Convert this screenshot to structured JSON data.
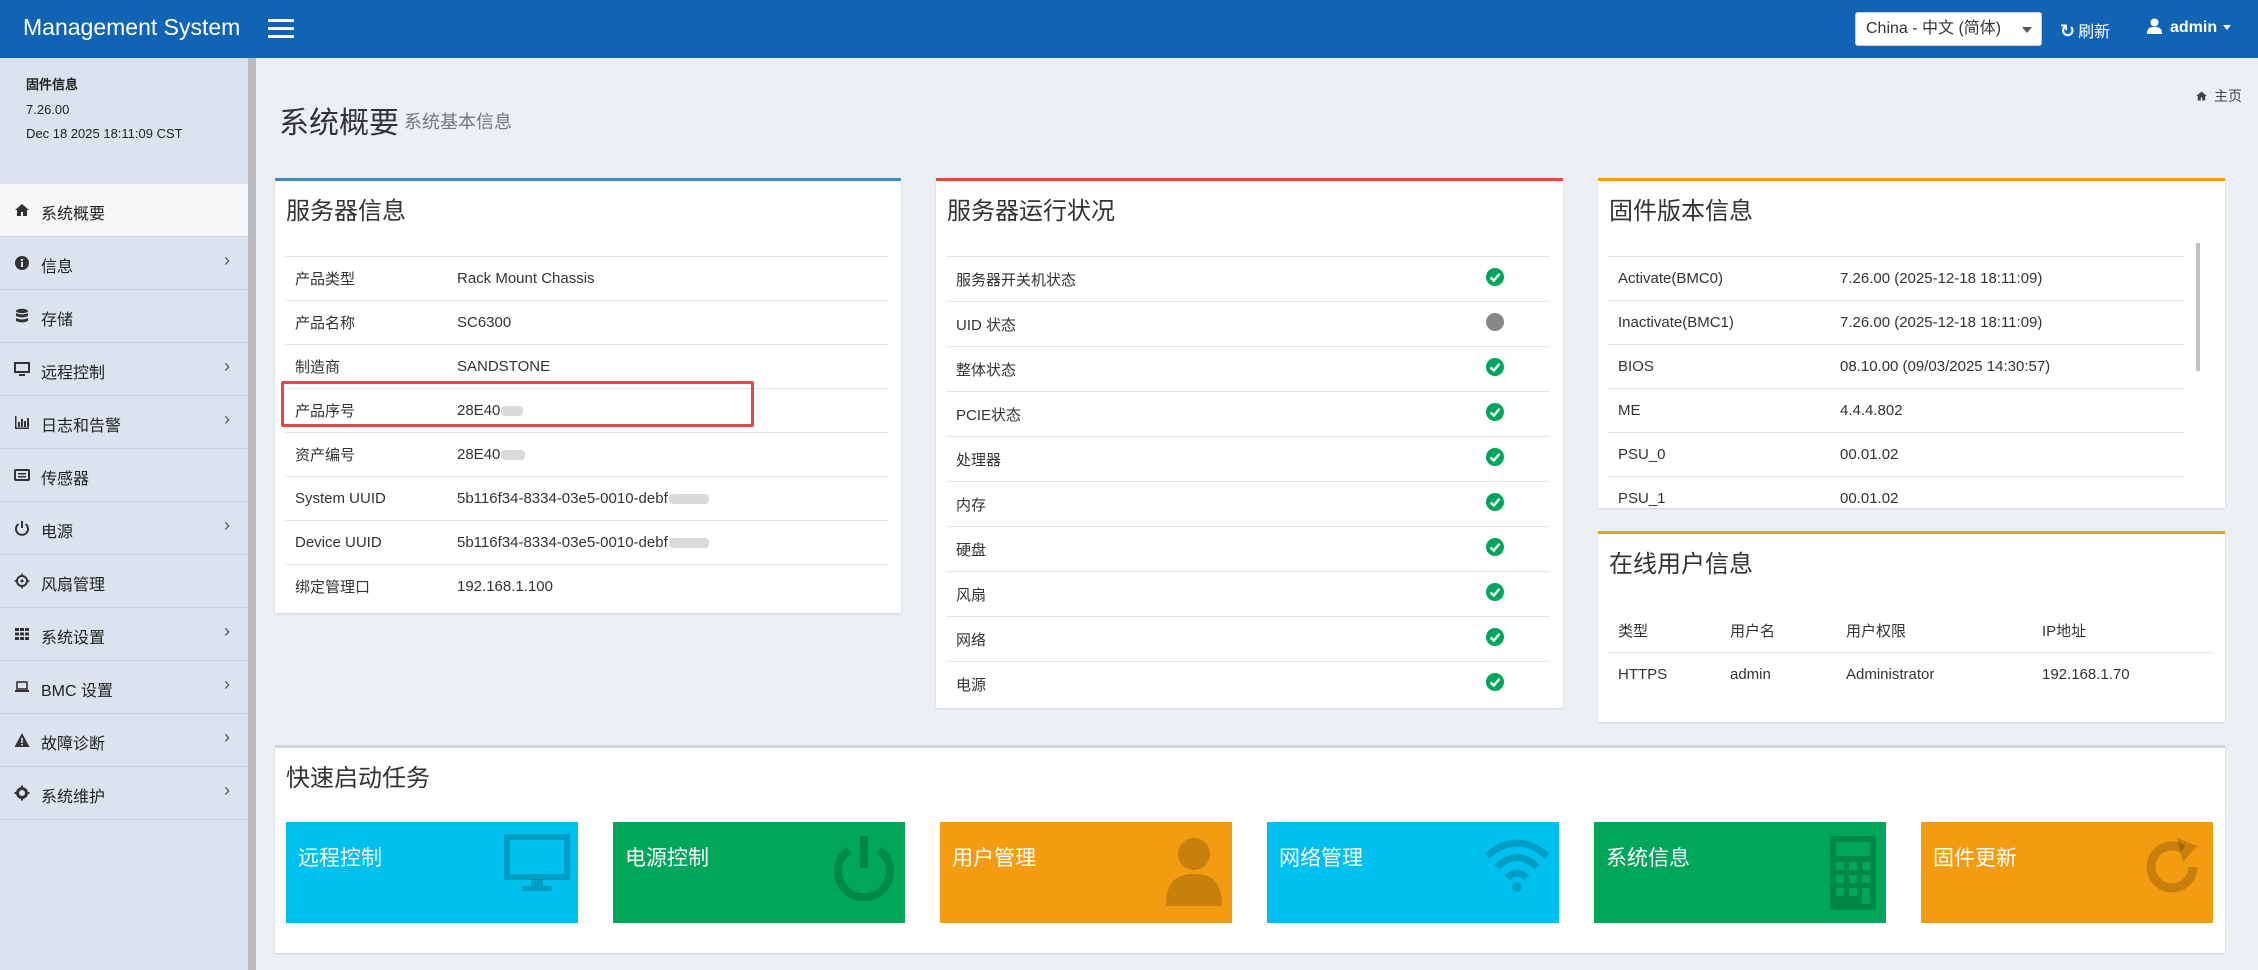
{
  "header": {
    "brand": "Management System",
    "language": "China - 中文 (简体)",
    "refresh_label": "刷新",
    "user_label": "admin"
  },
  "sidebar": {
    "firmware_title": "固件信息",
    "firmware_version": "7.26.00",
    "firmware_date": "Dec 18 2025 18:11:09 CST",
    "items": [
      {
        "label": "系统概要",
        "icon": "home-icon",
        "active": true
      },
      {
        "label": "信息",
        "icon": "info-icon"
      },
      {
        "label": "存储",
        "icon": "database-icon"
      },
      {
        "label": "远程控制",
        "icon": "monitor-icon"
      },
      {
        "label": "日志和告警",
        "icon": "chart-icon"
      },
      {
        "label": "传感器",
        "icon": "sensor-icon"
      },
      {
        "label": "电源",
        "icon": "power-icon"
      },
      {
        "label": "风扇管理",
        "icon": "fan-icon"
      },
      {
        "label": "系统设置",
        "icon": "grid-icon"
      },
      {
        "label": "BMC 设置",
        "icon": "laptop-icon"
      },
      {
        "label": "故障诊断",
        "icon": "warning-icon"
      },
      {
        "label": "系统维护",
        "icon": "gear-icon"
      }
    ]
  },
  "content": {
    "title": "系统概要",
    "subtitle": "系统基本信息",
    "breadcrumb": "主页"
  },
  "server_info": {
    "title": "服务器信息",
    "rows": [
      {
        "k": "产品类型",
        "v": "Rack Mount Chassis"
      },
      {
        "k": "产品名称",
        "v": "SC6300"
      },
      {
        "k": "制造商",
        "v": "SANDSTONE"
      },
      {
        "k": "产品序号",
        "v": "28E40"
      },
      {
        "k": "资产编号",
        "v": "28E40"
      },
      {
        "k": "System UUID",
        "v": "5b116f34-8334-03e5-0010-debf"
      },
      {
        "k": "Device UUID",
        "v": "5b116f34-8334-03e5-0010-debf"
      },
      {
        "k": "绑定管理口",
        "v": "192.168.1.100"
      }
    ]
  },
  "server_status": {
    "title": "服务器运行状况",
    "rows": [
      {
        "k": "服务器开关机状态",
        "status": "ok"
      },
      {
        "k": "UID 状态",
        "status": "off"
      },
      {
        "k": "整体状态",
        "status": "ok"
      },
      {
        "k": "PCIE状态",
        "status": "ok"
      },
      {
        "k": "处理器",
        "status": "ok"
      },
      {
        "k": "内存",
        "status": "ok"
      },
      {
        "k": "硬盘",
        "status": "ok"
      },
      {
        "k": "风扇",
        "status": "ok"
      },
      {
        "k": "网络",
        "status": "ok"
      },
      {
        "k": "电源",
        "status": "ok"
      }
    ]
  },
  "firmware_info": {
    "title": "固件版本信息",
    "rows": [
      {
        "k": "Activate(BMC0)",
        "v": "7.26.00 (2025-12-18 18:11:09)"
      },
      {
        "k": "Inactivate(BMC1)",
        "v": "7.26.00 (2025-12-18 18:11:09)"
      },
      {
        "k": "BIOS",
        "v": "08.10.00 (09/03/2025 14:30:57)"
      },
      {
        "k": "ME",
        "v": "4.4.4.802"
      },
      {
        "k": "PSU_0",
        "v": "00.01.02"
      },
      {
        "k": "PSU_1",
        "v": "00.01.02"
      }
    ]
  },
  "online_users": {
    "title": "在线用户信息",
    "headers": [
      "类型",
      "用户名",
      "用户权限",
      "IP地址"
    ],
    "rows": [
      [
        "HTTPS",
        "admin",
        "Administrator",
        "192.168.1.70"
      ]
    ]
  },
  "quick_tasks": {
    "title": "快速启动任务",
    "tiles": [
      {
        "label": "远程控制",
        "color": "#00c0ef",
        "icon": "monitor-icon"
      },
      {
        "label": "电源控制",
        "color": "#00a65a",
        "icon": "power-icon"
      },
      {
        "label": "用户管理",
        "color": "#f39c12",
        "icon": "user-icon"
      },
      {
        "label": "网络管理",
        "color": "#00c0ef",
        "icon": "wifi-icon"
      },
      {
        "label": "系统信息",
        "color": "#00a65a",
        "icon": "calculator-icon"
      },
      {
        "label": "固件更新",
        "color": "#f39c12",
        "icon": "refresh-icon"
      }
    ]
  },
  "colors": {
    "header": "#1164b4",
    "box_blue": "#3c8dbc",
    "box_red": "#dd4b39",
    "box_yellow": "#f39c12",
    "ok_green": "#00a65a",
    "highlight_red": "#e34949"
  }
}
